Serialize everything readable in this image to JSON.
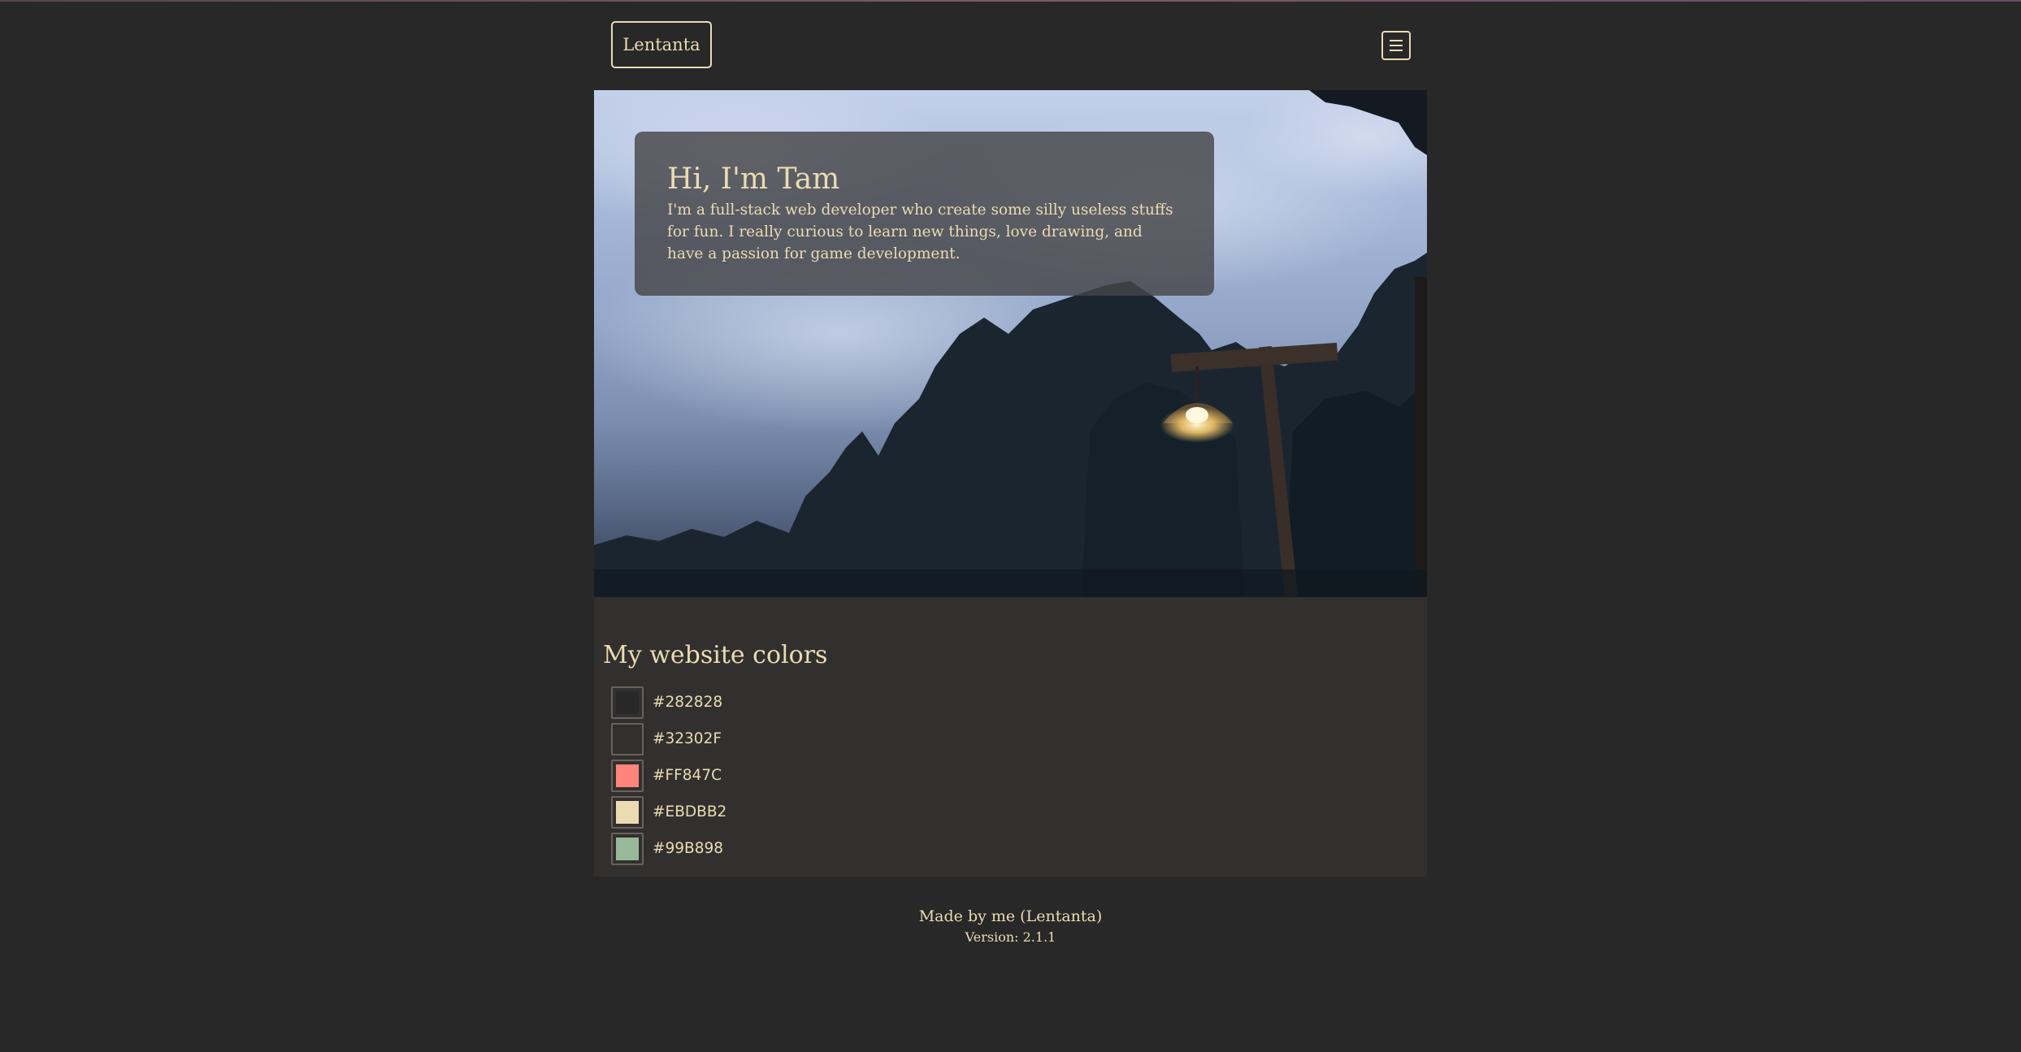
{
  "navbar": {
    "brand": "Lentanta",
    "menu_icon": "hamburger-icon"
  },
  "hero": {
    "title": "Hi, I'm Tam",
    "description": "I'm a full-stack web developer who create some silly useless stuffs for fun. I really curious to learn new things, love drawing, and have a passion for game development."
  },
  "colors_section": {
    "title": "My website colors",
    "colors": [
      {
        "hex": "#282828",
        "label": "#282828"
      },
      {
        "hex": "#32302F",
        "label": "#32302F"
      },
      {
        "hex": "#FF847C",
        "label": "#FF847C"
      },
      {
        "hex": "#EBDBB2",
        "label": "#EBDBB2"
      },
      {
        "hex": "#99B898",
        "label": "#99B898"
      }
    ]
  },
  "footer": {
    "made_by": "Made by me (Lentanta)",
    "version": "Version: 2.1.1"
  }
}
